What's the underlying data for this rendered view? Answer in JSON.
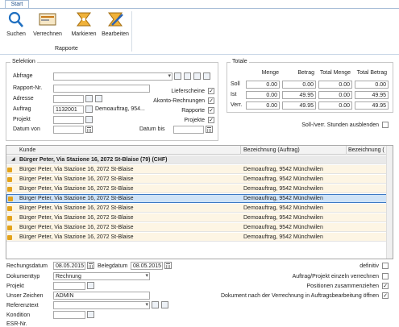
{
  "ribbon": {
    "tab": "Start",
    "buttons": [
      {
        "label": "Suchen",
        "icon": "search-icon"
      },
      {
        "label": "Verrechnen",
        "icon": "invoice-icon"
      },
      {
        "label": "Markieren",
        "icon": "mark-icon"
      },
      {
        "label": "Bearbeiten",
        "icon": "edit-icon"
      }
    ],
    "group_label": "Rapporte"
  },
  "selektion": {
    "title": "Selektion",
    "abfrage_label": "Abfrage",
    "rapport_label": "Rapport-Nr.",
    "adresse_label": "Adresse",
    "auftrag_label": "Auftrag",
    "auftrag_value": "1132001",
    "auftrag_desc": "Demoauftrag, 954...",
    "projekt_label": "Projekt",
    "datum_von_label": "Datum von",
    "datum_bis_label": "Datum bis",
    "checks": [
      {
        "label": "Lieferscheine",
        "checked": true
      },
      {
        "label": "Akonto-Rechnungen",
        "checked": true
      },
      {
        "label": "Rapporte",
        "checked": true
      },
      {
        "label": "Projekte",
        "checked": true
      }
    ]
  },
  "totale": {
    "title": "Totale",
    "headers": [
      "Menge",
      "Betrag",
      "Total Menge",
      "Total Betrag"
    ],
    "rows": [
      {
        "label": "Soll",
        "values": [
          "0.00",
          "0.00",
          "0.00",
          "0.00"
        ]
      },
      {
        "label": "Ist",
        "values": [
          "0.00",
          "49.95",
          "0.00",
          "49.95"
        ]
      },
      {
        "label": "Verr.",
        "values": [
          "0.00",
          "49.95",
          "0.00",
          "49.95"
        ]
      }
    ],
    "hide_label": "Soll-/verr. Stunden ausblenden"
  },
  "grid": {
    "headers": [
      "Kunde",
      "Bezeichnung (Auftrag)",
      "Bezeichnung ("
    ],
    "group_row": "Bürger Peter, Via Stazione 16, 2072 St-Blaise (79) (CHF)",
    "rows": [
      {
        "kunde": "Bürger Peter, Via Stazione 16, 2072 St-Blaise",
        "bez": "Demoauftrag, 9542 Münchwilen"
      },
      {
        "kunde": "Bürger Peter, Via Stazione 16, 2072 St-Blaise",
        "bez": "Demoauftrag, 9542 Münchwilen"
      },
      {
        "kunde": "Bürger Peter, Via Stazione 16, 2072 St-Blaise",
        "bez": "Demoauftrag, 9542 Münchwilen"
      },
      {
        "kunde": "Bürger Peter, Via Stazione 16, 2072 St-Blaise",
        "bez": "Demoauftrag, 9542 Münchwilen"
      },
      {
        "kunde": "Bürger Peter, Via Stazione 16, 2072 St-Blaise",
        "bez": "Demoauftrag, 9542 Münchwilen"
      },
      {
        "kunde": "Bürger Peter, Via Stazione 16, 2072 St-Blaise",
        "bez": "Demoauftrag, 9542 Münchwilen"
      },
      {
        "kunde": "Bürger Peter, Via Stazione 16, 2072 St-Blaise",
        "bez": "Demoauftrag, 9542 Münchwilen"
      },
      {
        "kunde": "Bürger Peter, Via Stazione 16, 2072 St-Blaise",
        "bez": "Demoauftrag, 9542 Münchwilen"
      }
    ]
  },
  "bottom": {
    "rechnungsdatum_label": "Rechungsdatum",
    "rechnungsdatum": "08.05.2015",
    "belegdatum_label": "Belegdatum",
    "belegdatum": "08.05.2015",
    "dokumenttyp_label": "Dokumenttyp",
    "dokumenttyp": "Rechnung",
    "projekt_label": "Projekt",
    "zeichen_label": "Unser Zeichen",
    "zeichen": "ADMIN",
    "referenz_label": "Referenztext",
    "kondition_label": "Kondition",
    "esr_label": "ESR-Nr.",
    "checks": [
      {
        "label": "definitiv",
        "checked": false
      },
      {
        "label": "Auftrag/Projekt einzeln verrechnen",
        "checked": false
      },
      {
        "label": "Positionen zusammenziehen",
        "checked": true
      },
      {
        "label": "Dokument nach der Verrechnung in Auftragsbearbeitung öffnen",
        "checked": true
      }
    ]
  },
  "colors": {
    "accent": "#1f4f8a",
    "selection": "#cfe3f7",
    "row": "#fdf5e4",
    "group": "#e9e9e9"
  }
}
